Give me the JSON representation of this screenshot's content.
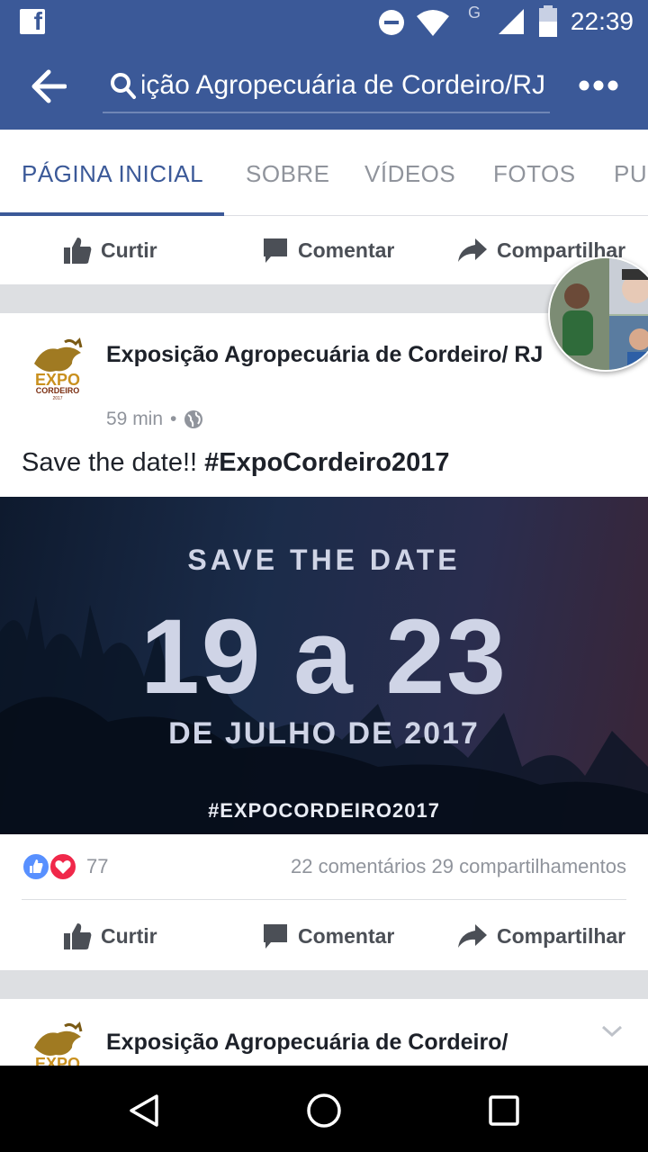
{
  "status_bar": {
    "time": "22:39",
    "network": "G"
  },
  "toolbar": {
    "search_text": "Exposição Agropecuária de Cordeiro/RJ"
  },
  "tabs": [
    {
      "label": "PÁGINA INICIAL",
      "active": true
    },
    {
      "label": "SOBRE",
      "active": false
    },
    {
      "label": "VÍDEOS",
      "active": false
    },
    {
      "label": "FOTOS",
      "active": false
    },
    {
      "label": "PU",
      "active": false
    }
  ],
  "actions": {
    "like": "Curtir",
    "comment": "Comentar",
    "share": "Compartilhar"
  },
  "post": {
    "page_name": "Exposição Agropecuária de Cordeiro/ RJ",
    "time": "59 min",
    "text_plain": "Save the date!! ",
    "hashtag": "#ExpoCordeiro2017",
    "logo_text": "EXPO",
    "logo_subtext": "CORDEIRO",
    "logo_year": "2017",
    "banner": {
      "line1": "SAVE THE DATE",
      "line2": "19 a 23",
      "line3": "DE JULHO DE 2017",
      "line4": "#EXPOCORDEIRO2017"
    },
    "reaction_count": "77",
    "comments": "22 comentários",
    "shares": "29 compartilhamentos"
  },
  "post2": {
    "page_name": "Exposição Agropecuária de Cordeiro/"
  },
  "colors": {
    "brand": "#3b5998",
    "text": "#1d2129",
    "muted": "#90949c"
  }
}
